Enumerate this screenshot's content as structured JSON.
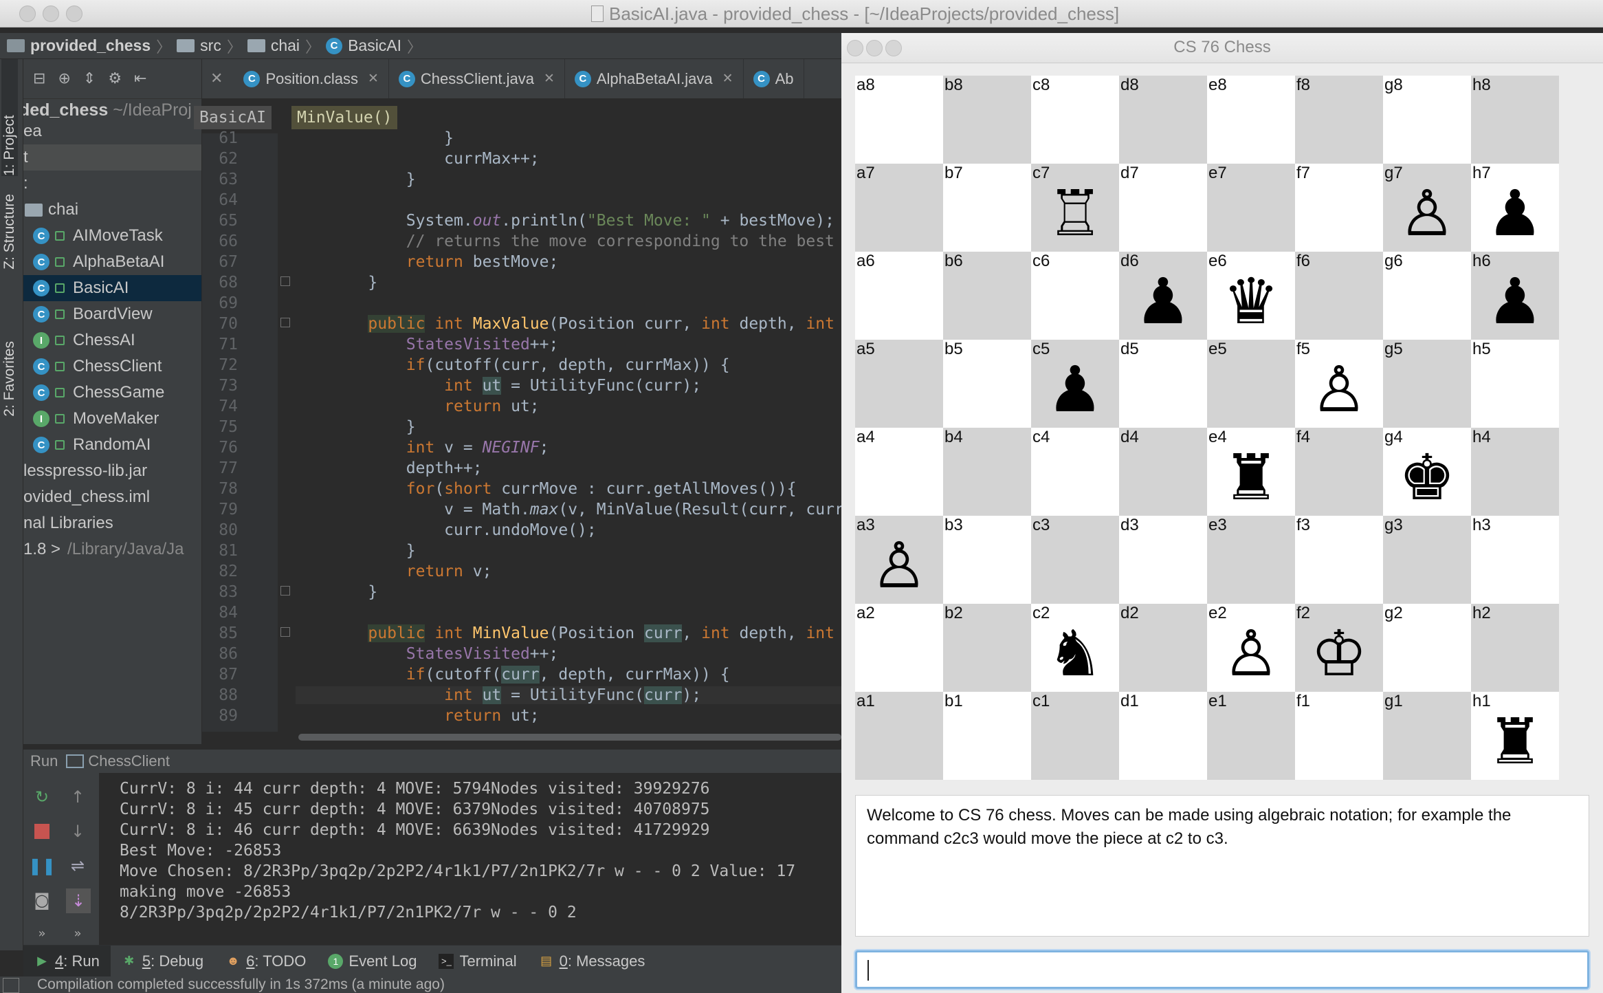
{
  "ide": {
    "window_title": "BasicAI.java - provided_chess - [~/IdeaProjects/provided_chess]",
    "navbar": {
      "project": "provided_chess",
      "folder1": "src",
      "folder2": "chai",
      "file": "BasicAI"
    },
    "left_tabs": {
      "project": "1: Project",
      "structure": "Z: Structure",
      "favorites": "2: Favorites"
    },
    "project_panel": {
      "root_name": "ded_chess",
      "root_path": "~/IdeaProj",
      "rows": [
        {
          "label": "ea"
        },
        {
          "label": "t"
        },
        {
          "label": ":"
        },
        {
          "label": "chai"
        },
        {
          "label": "AIMoveTask",
          "icon": "C"
        },
        {
          "label": "AlphaBetaAI",
          "icon": "C"
        },
        {
          "label": "BasicAI",
          "icon": "C"
        },
        {
          "label": "BoardView",
          "icon": "C"
        },
        {
          "label": "ChessAI",
          "icon": "I"
        },
        {
          "label": "ChessClient",
          "icon": "C"
        },
        {
          "label": "ChessGame",
          "icon": "C"
        },
        {
          "label": "MoveMaker",
          "icon": "I"
        },
        {
          "label": "RandomAI",
          "icon": "C"
        },
        {
          "label": "lesspresso-lib.jar"
        },
        {
          "label": "ovided_chess.iml"
        },
        {
          "label": "nal Libraries"
        },
        {
          "label": "1.8 >",
          "muted": "/Library/Java/Ja"
        }
      ]
    },
    "editor_tabs": [
      {
        "label": "Position.class"
      },
      {
        "label": "ChessClient.java"
      },
      {
        "label": "AlphaBetaAI.java"
      },
      {
        "label": "Ab"
      }
    ],
    "code_breadcrumb": {
      "cls": "BasicAI",
      "method": "MinValue()"
    },
    "line_numbers": [
      "61",
      "62",
      "63",
      "64",
      "65",
      "66",
      "67",
      "68",
      "69",
      "70",
      "71",
      "72",
      "73",
      "74",
      "75",
      "76",
      "77",
      "78",
      "79",
      "80",
      "81",
      "82",
      "83",
      "84",
      "85",
      "86",
      "87",
      "88",
      "89"
    ],
    "run_panel": {
      "title": "Run",
      "config": "ChessClient",
      "console": [
        "CurrV: 8 i: 44 curr depth: 4 MOVE: 5794Nodes visited: 39929276",
        "CurrV: 8 i: 45 curr depth: 4 MOVE: 6379Nodes visited: 40708975",
        "CurrV: 8 i: 46 curr depth: 4 MOVE: 6639Nodes visited: 41729929",
        "Best Move: -26853",
        "Move Chosen: 8/2R3Pp/3pq2p/2p2P2/4r1k1/P7/2n1PK2/7r w - - 0 2 Value: 17",
        "making move -26853",
        "8/2R3Pp/3pq2p/2p2P2/4r1k1/P7/2n1PK2/7r w - - 0 2"
      ]
    },
    "bottom_tabs": [
      {
        "num": "4",
        "rest": ": Run"
      },
      {
        "num": "5",
        "rest": ": Debug"
      },
      {
        "num": "6",
        "rest": ": TODO"
      },
      {
        "num": "",
        "rest": "Event Log"
      },
      {
        "num": "",
        "rest": "Terminal"
      },
      {
        "num": "0",
        "rest": ": Messages"
      }
    ],
    "status": "Compilation completed successfully in 1s 372ms (a minute ago)"
  },
  "chess": {
    "window_title": "CS 76 Chess",
    "files": [
      "a",
      "b",
      "c",
      "d",
      "e",
      "f",
      "g",
      "h"
    ],
    "ranks": [
      "8",
      "7",
      "6",
      "5",
      "4",
      "3",
      "2",
      "1"
    ],
    "pieces": {
      "c7": "♖",
      "g7": "♙",
      "h7": "♟",
      "d6": "♟",
      "e6": "♛",
      "h6": "♟",
      "c5": "♟",
      "f5": "♙",
      "e4": "♜",
      "g4": "♚",
      "a3": "♙",
      "c2": "♞",
      "e2": "♙",
      "f2": "♔",
      "h1": "♜"
    },
    "message": "Welcome to CS 76 chess.  Moves can be made using algebraic notation; for example the command c2c3 would move the piece at c2 to c3.",
    "input_value": ""
  }
}
